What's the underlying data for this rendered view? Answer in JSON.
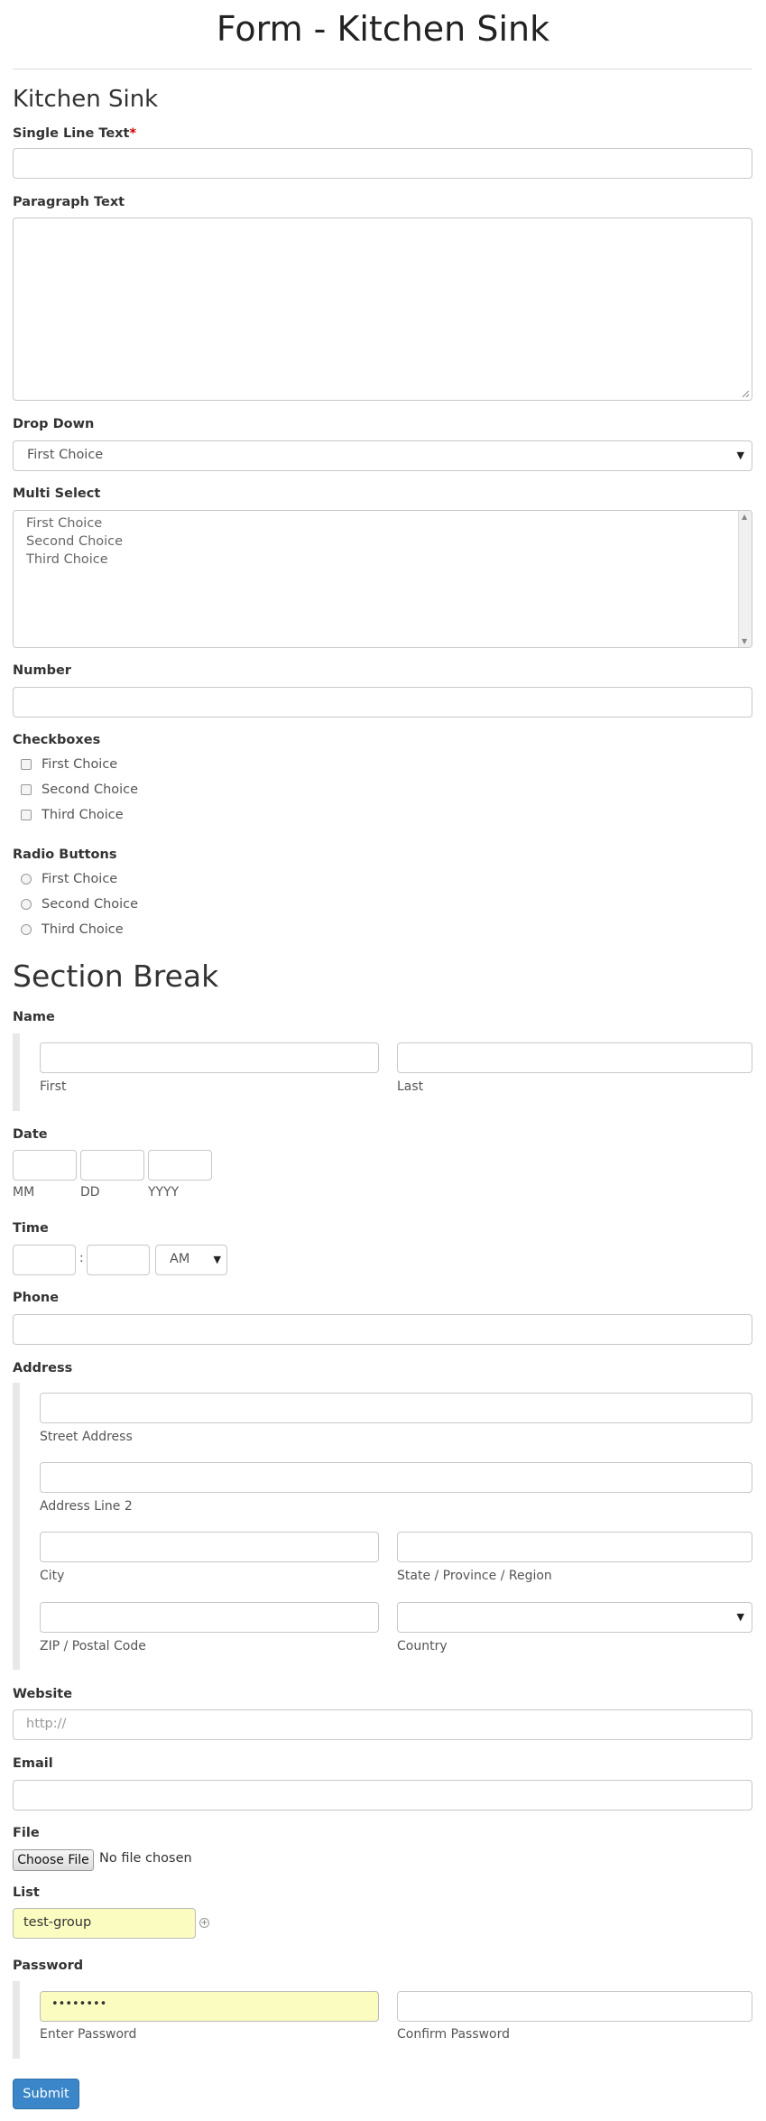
{
  "page": {
    "title": "Form - Kitchen Sink"
  },
  "form": {
    "heading": "Kitchen Sink",
    "single_line": {
      "label": "Single Line Text",
      "required_mark": "*"
    },
    "paragraph": {
      "label": "Paragraph Text"
    },
    "dropdown": {
      "label": "Drop Down",
      "value": "First Choice"
    },
    "multiselect": {
      "label": "Multi Select",
      "options": [
        "First Choice",
        "Second Choice",
        "Third Choice"
      ]
    },
    "number": {
      "label": "Number"
    },
    "checkboxes": {
      "label": "Checkboxes",
      "options": [
        "First Choice",
        "Second Choice",
        "Third Choice"
      ]
    },
    "radios": {
      "label": "Radio Buttons",
      "options": [
        "First Choice",
        "Second Choice",
        "Third Choice"
      ]
    },
    "section_break": "Section Break",
    "name": {
      "label": "Name",
      "first": "First",
      "last": "Last"
    },
    "date": {
      "label": "Date",
      "mm": "MM",
      "dd": "DD",
      "yyyy": "YYYY"
    },
    "time": {
      "label": "Time",
      "separator": ":",
      "ampm": "AM"
    },
    "phone": {
      "label": "Phone"
    },
    "address": {
      "label": "Address",
      "street": "Street Address",
      "line2": "Address Line 2",
      "city": "City",
      "state": "State / Province / Region",
      "zip": "ZIP / Postal Code",
      "country": "Country"
    },
    "website": {
      "label": "Website",
      "placeholder": "http://"
    },
    "email": {
      "label": "Email"
    },
    "file": {
      "label": "File",
      "button": "Choose File",
      "status": "No file chosen"
    },
    "list": {
      "label": "List",
      "value": "test-group",
      "add_symbol": "+"
    },
    "password": {
      "label": "Password",
      "value": "••••••••",
      "enter": "Enter Password",
      "confirm": "Confirm Password"
    },
    "submit": "Submit"
  },
  "colors": {
    "accent": "#3a86c8",
    "required": "#cc0000",
    "autofill": "#fafcc0"
  }
}
